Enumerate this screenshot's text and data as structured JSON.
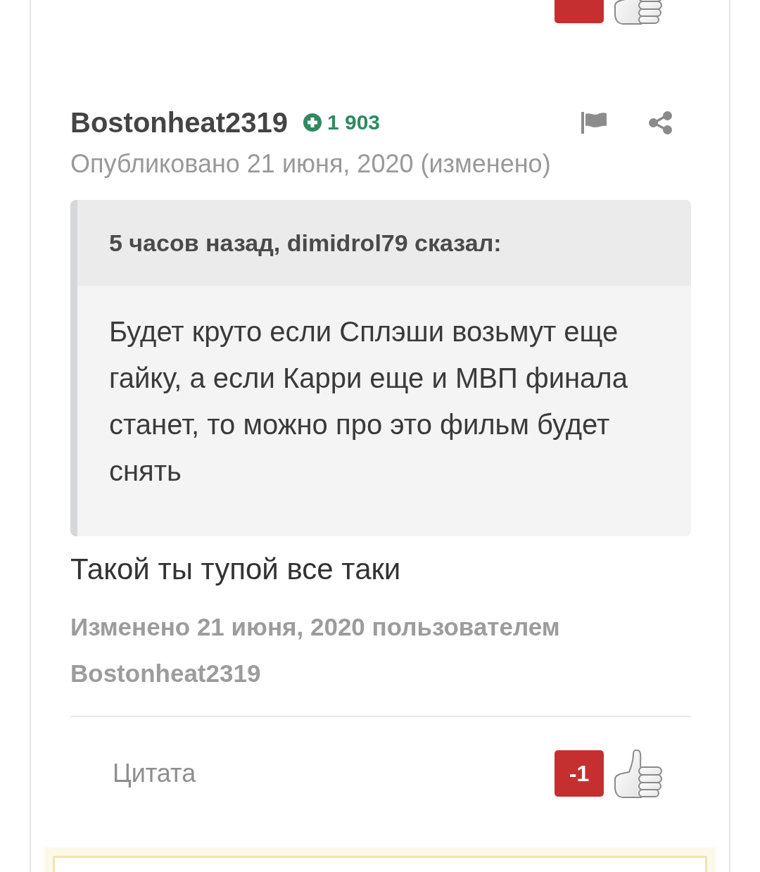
{
  "previous_post": {
    "footer_visible": true
  },
  "post": {
    "author": "Bostonheat2319",
    "reputation": "1 903",
    "published": "Опубликовано 21 июня, 2020 (изменено)",
    "quote": {
      "citation": "5 часов назад, dimidrol79 сказал:",
      "text": "Будет круто если Сплэши возьмут еще гайку, а если Карри еще и МВП финала станет, то можно про это фильм будет снять"
    },
    "body": "Такой ты тупой все таки",
    "edit_note": "Изменено 21 июня, 2020 пользователем Bostonheat2319",
    "footer": {
      "quote_label": "Цитата",
      "reaction_count": "-1"
    }
  }
}
